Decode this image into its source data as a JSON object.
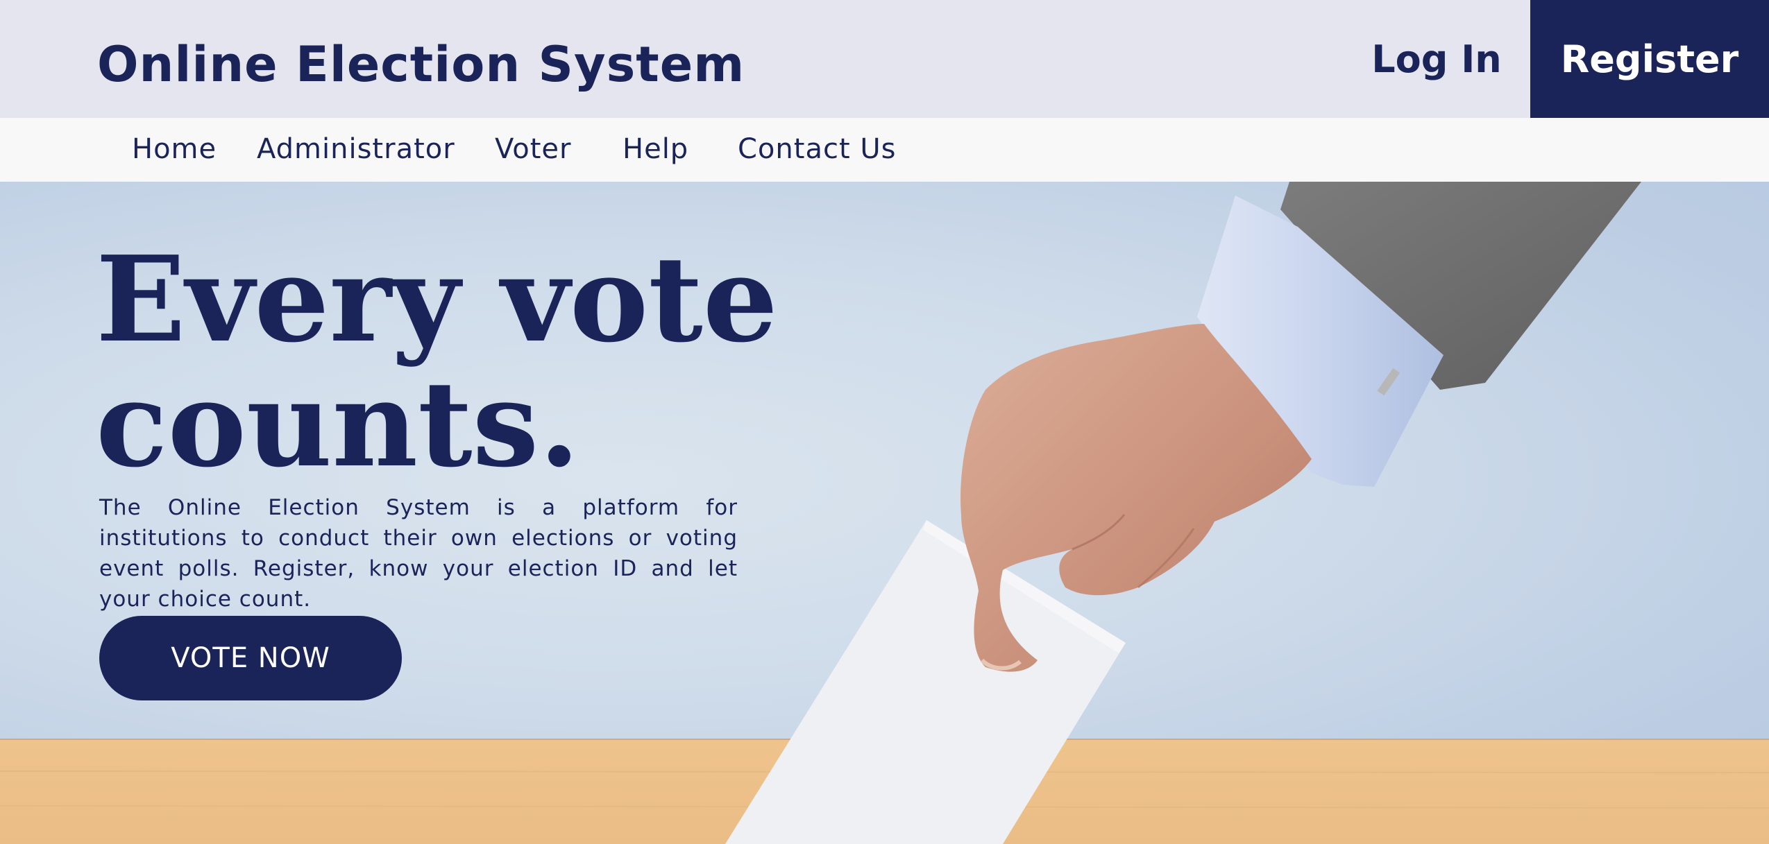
{
  "header": {
    "title": "Online Election System",
    "login_label": "Log In",
    "register_label": "Register"
  },
  "nav": {
    "items": [
      {
        "label": "Home"
      },
      {
        "label": "Administrator"
      },
      {
        "label": "Voter"
      },
      {
        "label": "Help"
      },
      {
        "label": "Contact Us"
      }
    ]
  },
  "hero": {
    "headline_line1": "Every vote",
    "headline_line2": "counts.",
    "description": "The Online Election System is a platform for institutions to conduct their own elections or voting event polls. Register, know your election ID and let your choice count.",
    "cta_label": "VOTE NOW",
    "image_subject": "hand-casting-ballot-illustration"
  },
  "colors": {
    "brand_navy": "#1a2459",
    "header_bg": "#e4e5ee",
    "nav_bg": "#f8f8f8",
    "hero_bg": "#cfdcea",
    "table_wood": "#ecc38d"
  }
}
